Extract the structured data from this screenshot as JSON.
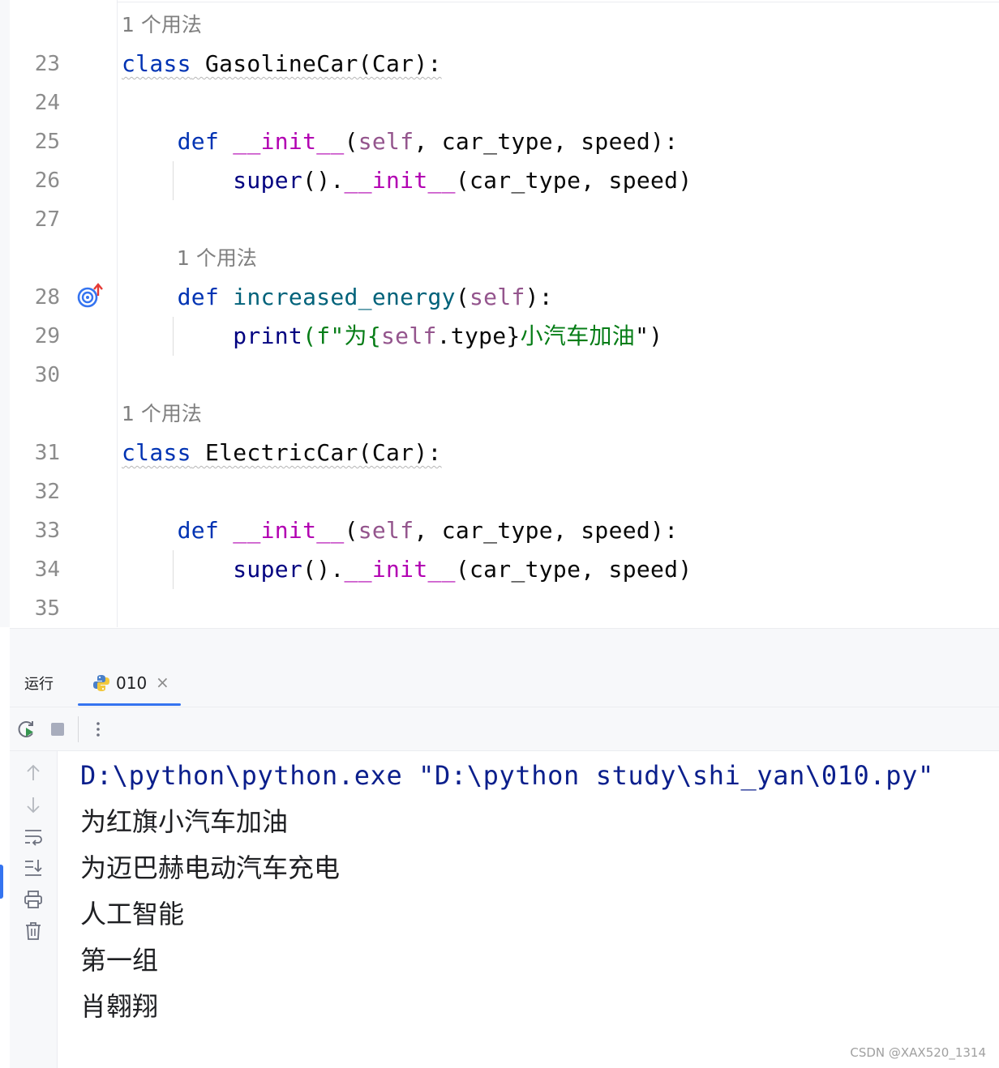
{
  "editor": {
    "line_numbers": [
      "23",
      "24",
      "25",
      "26",
      "27",
      "28",
      "29",
      "30",
      "31",
      "32",
      "33",
      "34",
      "35"
    ],
    "usage_hint_1": "1 个用法",
    "usage_hint_2": "1 个用法",
    "usage_hint_3": "1 个用法",
    "l23": {
      "kw": "class",
      "name": " GasolineCar(Car):"
    },
    "l25": {
      "kw": "def",
      "sp": " ",
      "init": "__init__",
      "p1": "(",
      "self": "self",
      "rest": ", car_type, speed):"
    },
    "l26": {
      "super": "super",
      "mid": "().",
      "init": "__init__",
      "rest": "(car_type, speed)"
    },
    "l28": {
      "kw": "def",
      "sp": " ",
      "fn": "increased_energy",
      "p1": "(",
      "self": "self",
      "rest": "):"
    },
    "l29": {
      "print": "print",
      "open": "(f\"为{",
      "self": "self",
      "dot": ".type}",
      "str": "小汽车加油",
      "close": "\")"
    },
    "l31": {
      "kw": "class",
      "name": " ElectricCar(Car):"
    },
    "l33": {
      "kw": "def",
      "sp": " ",
      "init": "__init__",
      "p1": "(",
      "self": "self",
      "rest": ", car_type, speed):"
    },
    "l34": {
      "super": "super",
      "mid": "().",
      "init": "__init__",
      "rest": "(car_type, speed)"
    }
  },
  "run_panel": {
    "title": "运行",
    "tab_label": "010",
    "tab_close": "×",
    "output": [
      "D:\\python\\python.exe \"D:\\python study\\shi_yan\\010.py\"",
      "为红旗小汽车加油",
      "为迈巴赫电动汽车充电",
      "人工智能",
      "第一组",
      "肖翱翔"
    ]
  },
  "icons": {
    "gutter": "override-target-icon",
    "tab": "python-icon",
    "toolbar": [
      "rerun-icon",
      "stop-icon",
      "more-icon"
    ],
    "side": [
      "scroll-up-icon",
      "scroll-down-icon",
      "soft-wrap-icon",
      "scroll-to-end-icon",
      "print-icon",
      "trash-icon"
    ]
  },
  "colors": {
    "keyword": "#0033b3",
    "dunder": "#b200b2",
    "self": "#94558d",
    "function": "#00627a",
    "string": "#067d17",
    "accent": "#3574f0"
  },
  "watermark": "CSDN @XAX520_1314"
}
